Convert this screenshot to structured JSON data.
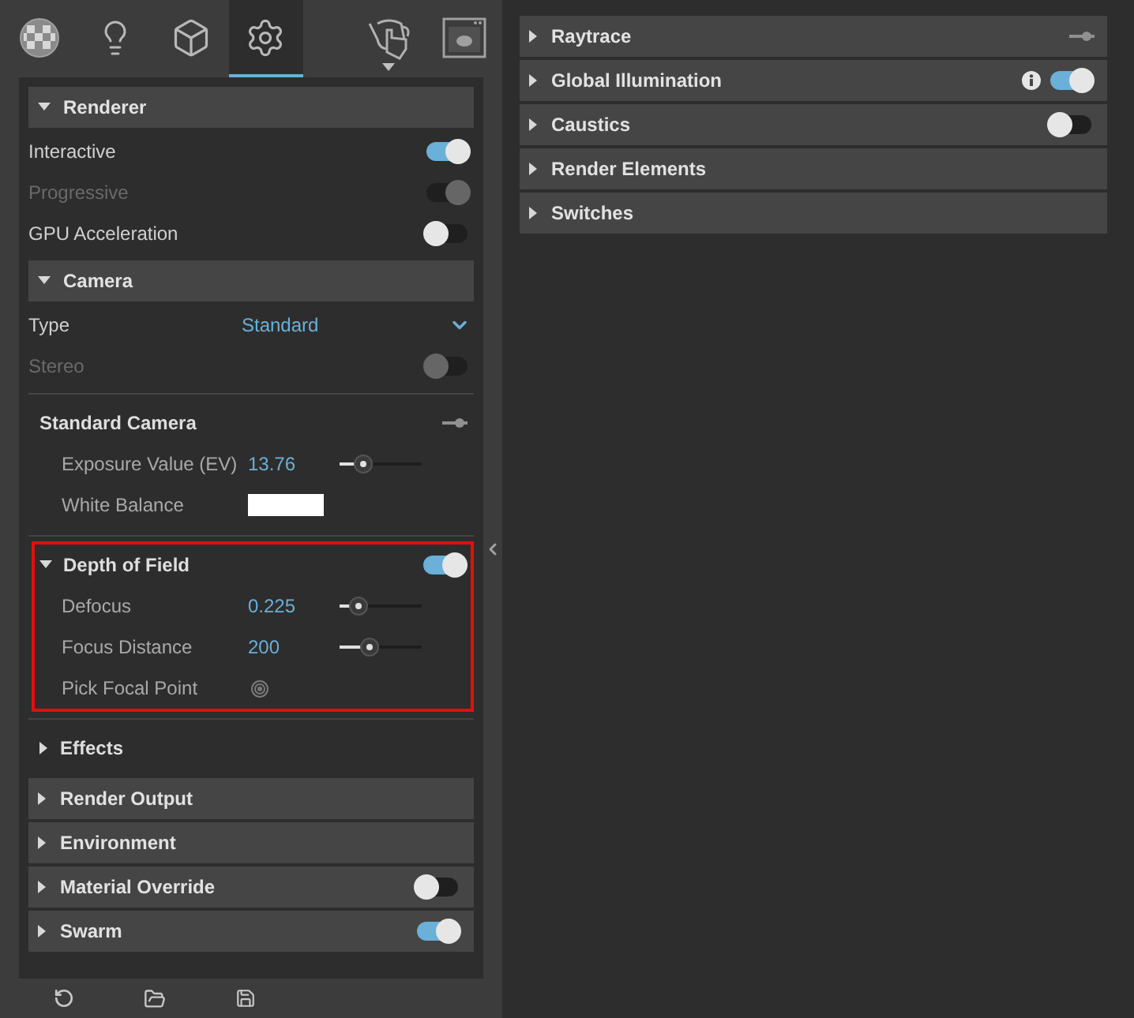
{
  "toolbar": {
    "tabs": [
      {
        "kind": "material",
        "selected": false
      },
      {
        "kind": "light",
        "selected": false
      },
      {
        "kind": "object",
        "selected": false
      },
      {
        "kind": "settings",
        "selected": true
      },
      {
        "kind": "interact",
        "selected": false,
        "has_menu": true
      },
      {
        "kind": "render",
        "selected": false
      }
    ]
  },
  "left_sections": [
    {
      "title": "Renderer",
      "expanded": true,
      "kind": "plain",
      "rows": [
        {
          "kind": "toggle",
          "label": "Interactive",
          "on": true,
          "disabled": false
        },
        {
          "kind": "toggle",
          "label": "Progressive",
          "on": true,
          "disabled": true
        },
        {
          "kind": "toggle",
          "label": "GPU Acceleration",
          "on": false,
          "disabled": false
        }
      ]
    },
    {
      "title": "Camera",
      "expanded": true,
      "kind": "plain",
      "rows": [
        {
          "kind": "dropdown",
          "label": "Type",
          "value": "Standard"
        },
        {
          "kind": "toggle",
          "label": "Stereo",
          "on": false,
          "disabled": true
        }
      ],
      "groups": [
        {
          "title": "Standard Camera",
          "kind": "pin",
          "highlighted": false,
          "rows": [
            {
              "kind": "slider",
              "label": "Exposure Value (EV)",
              "value": "13.76",
              "level": 0.29
            },
            {
              "kind": "color",
              "label": "White Balance",
              "color": "#ffffff"
            }
          ]
        },
        {
          "title": "Depth of Field",
          "kind": "toggle",
          "expanded": true,
          "on": true,
          "highlighted": true,
          "rows": [
            {
              "kind": "slider",
              "label": "Defocus",
              "value": "0.225",
              "level": 0.23
            },
            {
              "kind": "slider",
              "label": "Focus Distance",
              "value": "200",
              "level": 0.37
            },
            {
              "kind": "picker",
              "label": "Pick Focal Point"
            }
          ]
        },
        {
          "title": "Effects",
          "kind": "plain",
          "expanded": false,
          "highlighted": false
        }
      ]
    },
    {
      "title": "Render Output",
      "expanded": false,
      "kind": "plain"
    },
    {
      "title": "Environment",
      "expanded": false,
      "kind": "plain"
    },
    {
      "title": "Material Override",
      "expanded": false,
      "kind": "toggle",
      "on": false
    },
    {
      "title": "Swarm",
      "expanded": false,
      "kind": "toggle",
      "on": true
    }
  ],
  "right_sections": [
    {
      "title": "Raytrace",
      "expanded": false,
      "kind": "pin"
    },
    {
      "title": "Global Illumination",
      "expanded": false,
      "kind": "info-toggle",
      "on": true
    },
    {
      "title": "Caustics",
      "expanded": false,
      "kind": "toggle",
      "on": false
    },
    {
      "title": "Render Elements",
      "expanded": false,
      "kind": "plain"
    },
    {
      "title": "Switches",
      "expanded": false,
      "kind": "plain"
    }
  ]
}
